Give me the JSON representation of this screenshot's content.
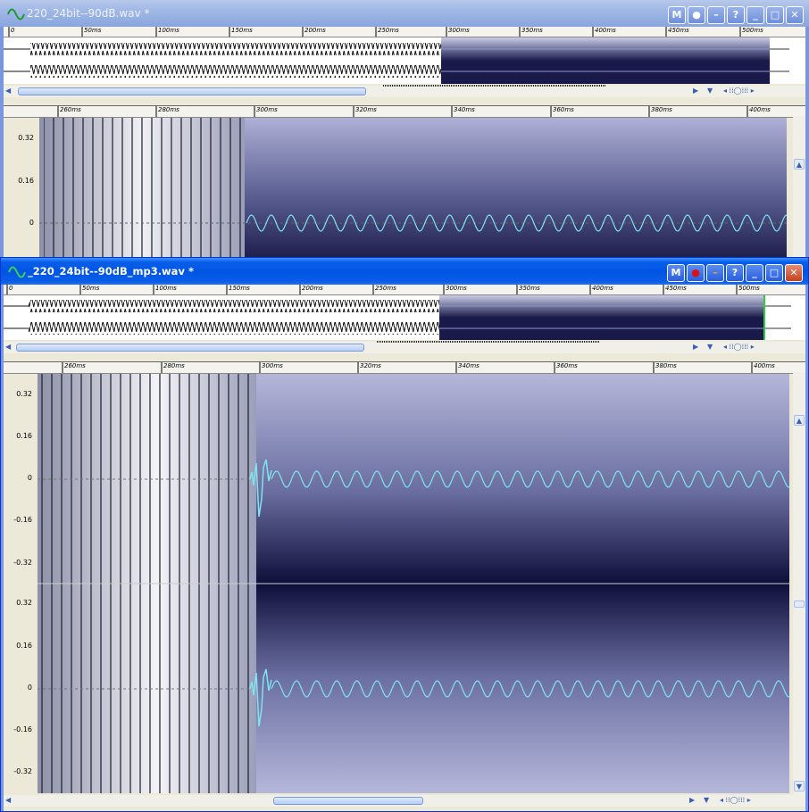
{
  "windows": [
    {
      "title": "220_24bit--90dB.wav *",
      "buttons": [
        "M",
        "●",
        "–",
        "?",
        "_",
        "□",
        "✕"
      ],
      "overview_ruler": [
        "0",
        "50ms",
        "100ms",
        "150ms",
        "200ms",
        "250ms",
        "300ms",
        "350ms",
        "400ms",
        "450ms",
        "500ms"
      ],
      "detail_ruler": [
        "260ms",
        "280ms",
        "300ms",
        "320ms",
        "340ms",
        "360ms",
        "380ms",
        "400ms"
      ],
      "y_labels": [
        "0.32",
        "0.16",
        "0"
      ]
    },
    {
      "title": "_220_24bit--90dB_mp3.wav *",
      "buttons": [
        "M",
        "●",
        "–",
        "?",
        "_",
        "□",
        "✕"
      ],
      "overview_ruler": [
        "0",
        "50ms",
        "100ms",
        "150ms",
        "200ms",
        "250ms",
        "300ms",
        "350ms",
        "400ms",
        "450ms",
        "500ms"
      ],
      "detail_ruler": [
        "260ms",
        "280ms",
        "300ms",
        "320ms",
        "340ms",
        "360ms",
        "380ms",
        "400ms"
      ],
      "y_labels_top": [
        "0.32",
        "0.16",
        "0",
        "-0.16",
        "-0.32"
      ],
      "y_labels_bottom": [
        "0.32",
        "0.16",
        "0",
        "-0.16",
        "-0.32"
      ]
    }
  ],
  "colors": {
    "waveform": "#7fe3f0",
    "selection_overview": "#1a1a4a",
    "cursor": "#2ecc40"
  },
  "icons": {
    "app": "sine-wave-icon",
    "scroll_left": "arrow-left-icon",
    "scroll_right": "arrow-right-icon",
    "dropdown": "chevron-down-icon",
    "zoom": "zoom-slider-icon"
  }
}
